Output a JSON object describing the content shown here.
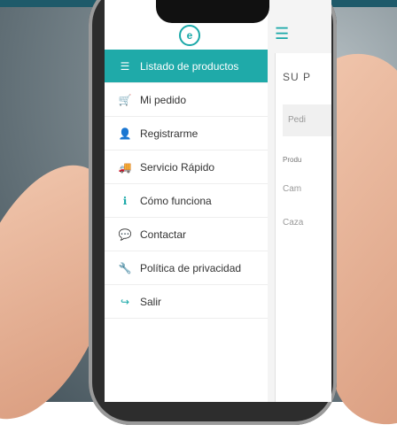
{
  "app": {
    "logo_text": "e"
  },
  "menu": {
    "items": [
      {
        "icon": "list-icon",
        "label": "Listado de productos",
        "active": true
      },
      {
        "icon": "cart-icon",
        "label": "Mi pedido"
      },
      {
        "icon": "user-icon",
        "label": "Registrarme"
      },
      {
        "icon": "truck-icon",
        "label": "Servicio Rápido"
      },
      {
        "icon": "info-icon",
        "label": "Cómo funciona"
      },
      {
        "icon": "chat-icon",
        "label": "Contactar"
      },
      {
        "icon": "wrench-icon",
        "label": "Política de privacidad"
      },
      {
        "icon": "logout-icon",
        "label": "Salir"
      }
    ]
  },
  "content": {
    "title": "SU P",
    "pedido_placeholder": "Pedi",
    "products_label": "Produ",
    "row1": "Cam",
    "row2": "Caza"
  },
  "colors": {
    "accent": "#1faaa9"
  }
}
